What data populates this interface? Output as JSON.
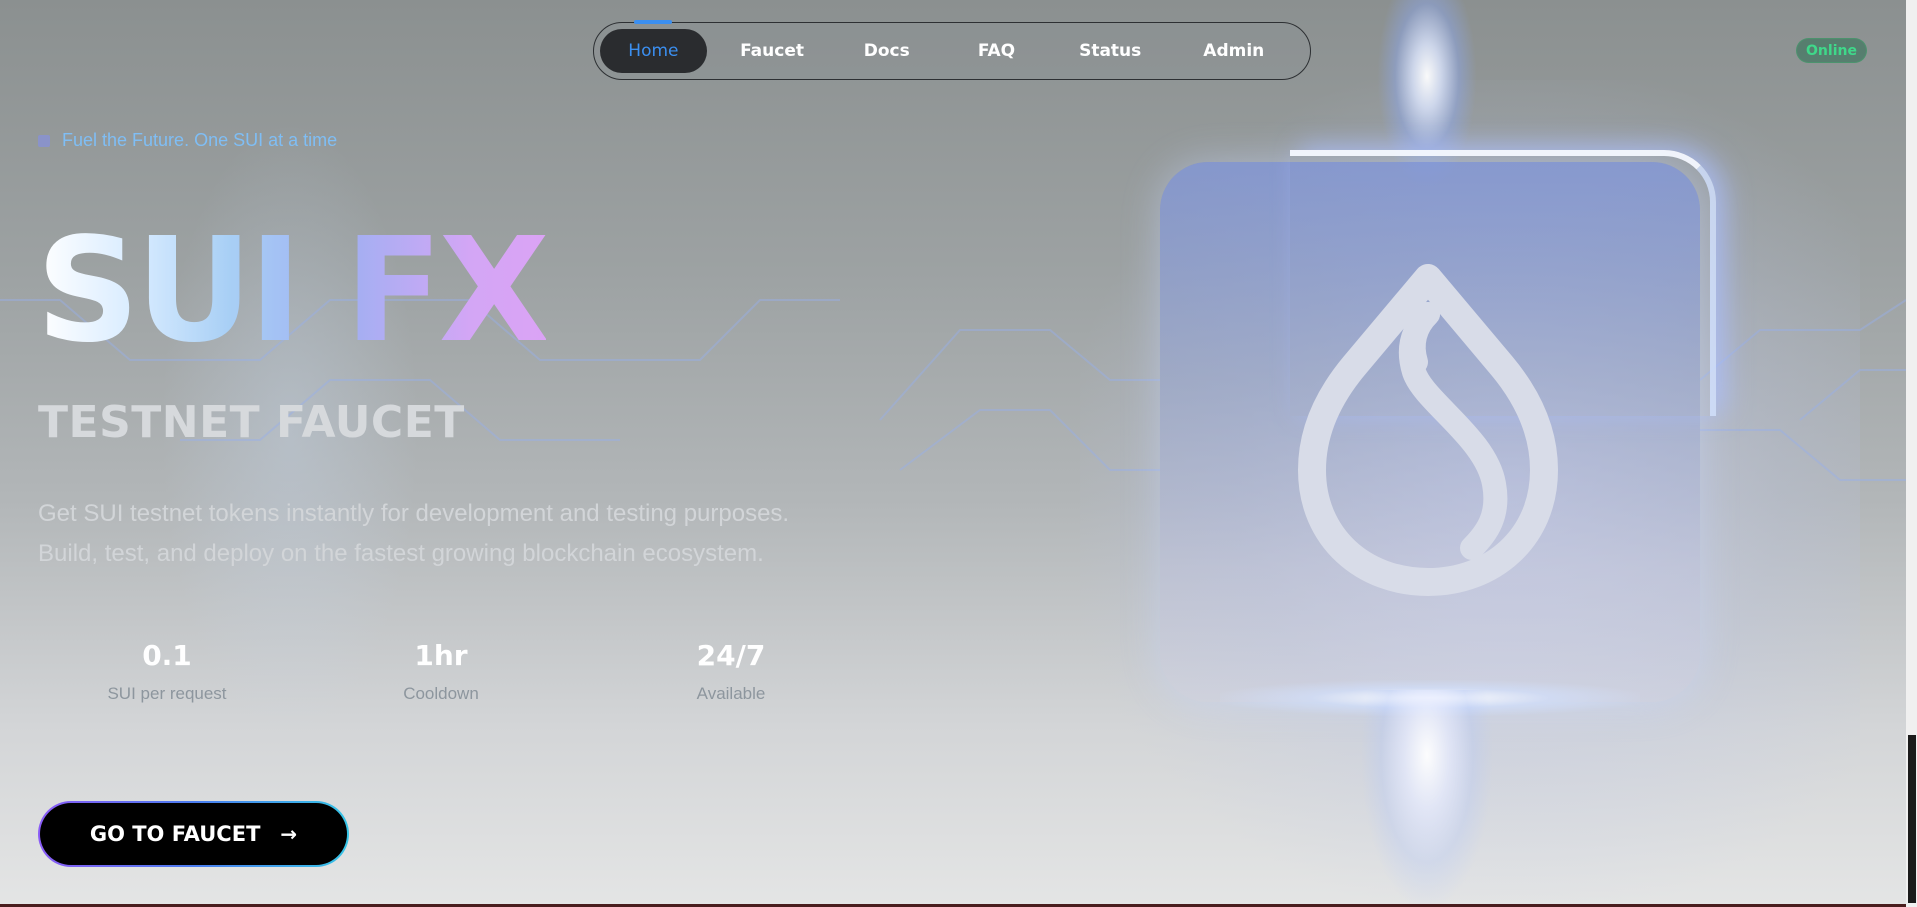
{
  "nav": {
    "items": [
      {
        "label": "Home",
        "active": true
      },
      {
        "label": "Faucet",
        "active": false
      },
      {
        "label": "Docs",
        "active": false
      },
      {
        "label": "FAQ",
        "active": false
      },
      {
        "label": "Status",
        "active": false
      },
      {
        "label": "Admin",
        "active": false
      }
    ]
  },
  "status": {
    "label": "Online",
    "color": "#3fd88a"
  },
  "hero": {
    "tagline": "Fuel the Future. One SUI at a time",
    "title": "SUI FX",
    "subtitle": "TESTNET FAUCET",
    "description_line1": "Get SUI testnet tokens instantly for development and testing purposes.",
    "description_line2": "Build, test, and deploy on the fastest growing blockchain ecosystem."
  },
  "stats": [
    {
      "value": "0.1",
      "label": "SUI per request"
    },
    {
      "value": "1hr",
      "label": "Cooldown"
    },
    {
      "value": "24/7",
      "label": "Available"
    }
  ],
  "cta": {
    "label": "GO TO FAUCET",
    "icon": "arrow-right-icon"
  },
  "logo": {
    "icon": "sui-droplet-icon"
  },
  "colors": {
    "accent": "#3b8ff0",
    "tagline": "#7fbef5",
    "online": "#3fd88a"
  }
}
